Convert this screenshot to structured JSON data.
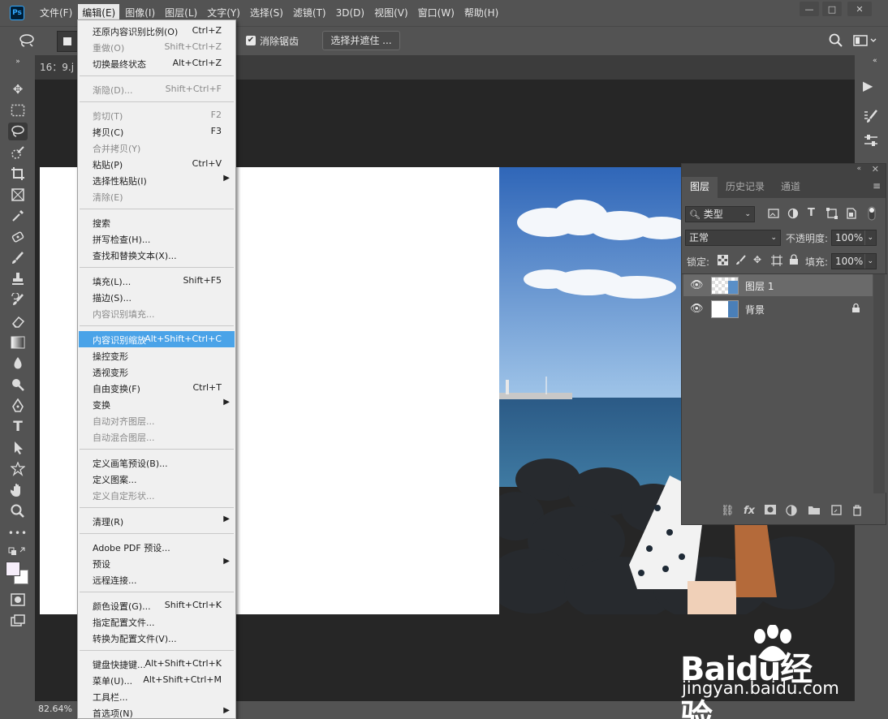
{
  "app": {
    "logo_text": "Ps"
  },
  "menubar": {
    "items": [
      "文件(F)",
      "编辑(E)",
      "图像(I)",
      "图层(L)",
      "文字(Y)",
      "选择(S)",
      "滤镜(T)",
      "3D(D)",
      "视图(V)",
      "窗口(W)",
      "帮助(H)"
    ],
    "active_index": 1
  },
  "options": {
    "antialias_label": "消除锯齿",
    "antialias_checked": true,
    "select_and_mask": "选择并遮住 ..."
  },
  "document": {
    "tab_title": "16：9.j",
    "zoom": "82.64%"
  },
  "edit_menu": {
    "items": [
      {
        "label": "还原内容识别比例(O)",
        "shortcut": "Ctrl+Z",
        "enabled": true
      },
      {
        "label": "重做(O)",
        "shortcut": "Shift+Ctrl+Z",
        "enabled": false
      },
      {
        "label": "切换最终状态",
        "shortcut": "Alt+Ctrl+Z",
        "enabled": true
      },
      {
        "sep": true
      },
      {
        "label": "渐隐(D)...",
        "shortcut": "Shift+Ctrl+F",
        "enabled": false
      },
      {
        "sep": true
      },
      {
        "label": "剪切(T)",
        "shortcut": "F2",
        "enabled": false
      },
      {
        "label": "拷贝(C)",
        "shortcut": "F3",
        "enabled": true
      },
      {
        "label": "合并拷贝(Y)",
        "shortcut": "",
        "enabled": false
      },
      {
        "label": "粘贴(P)",
        "shortcut": "Ctrl+V",
        "enabled": true
      },
      {
        "label": "选择性粘贴(I)",
        "shortcut": "",
        "enabled": true,
        "submenu": true
      },
      {
        "label": "清除(E)",
        "shortcut": "",
        "enabled": false
      },
      {
        "sep": true
      },
      {
        "label": "搜索",
        "shortcut": "",
        "enabled": true
      },
      {
        "label": "拼写检查(H)...",
        "shortcut": "",
        "enabled": true
      },
      {
        "label": "查找和替换文本(X)...",
        "shortcut": "",
        "enabled": true
      },
      {
        "sep": true
      },
      {
        "label": "填充(L)...",
        "shortcut": "Shift+F5",
        "enabled": true
      },
      {
        "label": "描边(S)...",
        "shortcut": "",
        "enabled": true
      },
      {
        "label": "内容识别填充...",
        "shortcut": "",
        "enabled": false
      },
      {
        "sep": true
      },
      {
        "label": "内容识别缩放",
        "shortcut": "Alt+Shift+Ctrl+C",
        "enabled": true,
        "highlighted": true
      },
      {
        "label": "操控变形",
        "shortcut": "",
        "enabled": true
      },
      {
        "label": "透视变形",
        "shortcut": "",
        "enabled": true
      },
      {
        "label": "自由变换(F)",
        "shortcut": "Ctrl+T",
        "enabled": true
      },
      {
        "label": "变换",
        "shortcut": "",
        "enabled": true,
        "submenu": true
      },
      {
        "label": "自动对齐图层...",
        "shortcut": "",
        "enabled": false
      },
      {
        "label": "自动混合图层...",
        "shortcut": "",
        "enabled": false
      },
      {
        "sep": true
      },
      {
        "label": "定义画笔预设(B)...",
        "shortcut": "",
        "enabled": true
      },
      {
        "label": "定义图案...",
        "shortcut": "",
        "enabled": true
      },
      {
        "label": "定义自定形状...",
        "shortcut": "",
        "enabled": false
      },
      {
        "sep": true
      },
      {
        "label": "清理(R)",
        "shortcut": "",
        "enabled": true,
        "submenu": true
      },
      {
        "sep": true
      },
      {
        "label": "Adobe PDF 预设...",
        "shortcut": "",
        "enabled": true
      },
      {
        "label": "预设",
        "shortcut": "",
        "enabled": true,
        "submenu": true
      },
      {
        "label": "远程连接...",
        "shortcut": "",
        "enabled": true
      },
      {
        "sep": true
      },
      {
        "label": "颜色设置(G)...",
        "shortcut": "Shift+Ctrl+K",
        "enabled": true
      },
      {
        "label": "指定配置文件...",
        "shortcut": "",
        "enabled": true
      },
      {
        "label": "转换为配置文件(V)...",
        "shortcut": "",
        "enabled": true
      },
      {
        "sep": true
      },
      {
        "label": "键盘快捷键...",
        "shortcut": "Alt+Shift+Ctrl+K",
        "enabled": true
      },
      {
        "label": "菜单(U)...",
        "shortcut": "Alt+Shift+Ctrl+M",
        "enabled": true
      },
      {
        "label": "工具栏...",
        "shortcut": "",
        "enabled": true
      },
      {
        "label": "首选项(N)",
        "shortcut": "",
        "enabled": true,
        "submenu": true
      }
    ]
  },
  "layers_panel": {
    "tabs": [
      "图层",
      "历史记录",
      "通道"
    ],
    "active_tab": 0,
    "filter_kind": "类型",
    "blend_mode": "正常",
    "opacity_label": "不透明度:",
    "opacity_value": "100%",
    "lock_label": "锁定:",
    "fill_label": "填充:",
    "fill_value": "100%",
    "layers": [
      {
        "name": "图层 1",
        "selected": true,
        "locked": false
      },
      {
        "name": "背景",
        "selected": false,
        "locked": true
      }
    ]
  },
  "watermark": {
    "brand": "Baidu经验",
    "url": "jingyan.baidu.com"
  },
  "colors": {
    "highlight": "#4aa3e8",
    "panel": "#535353",
    "canvas": "#262626"
  }
}
